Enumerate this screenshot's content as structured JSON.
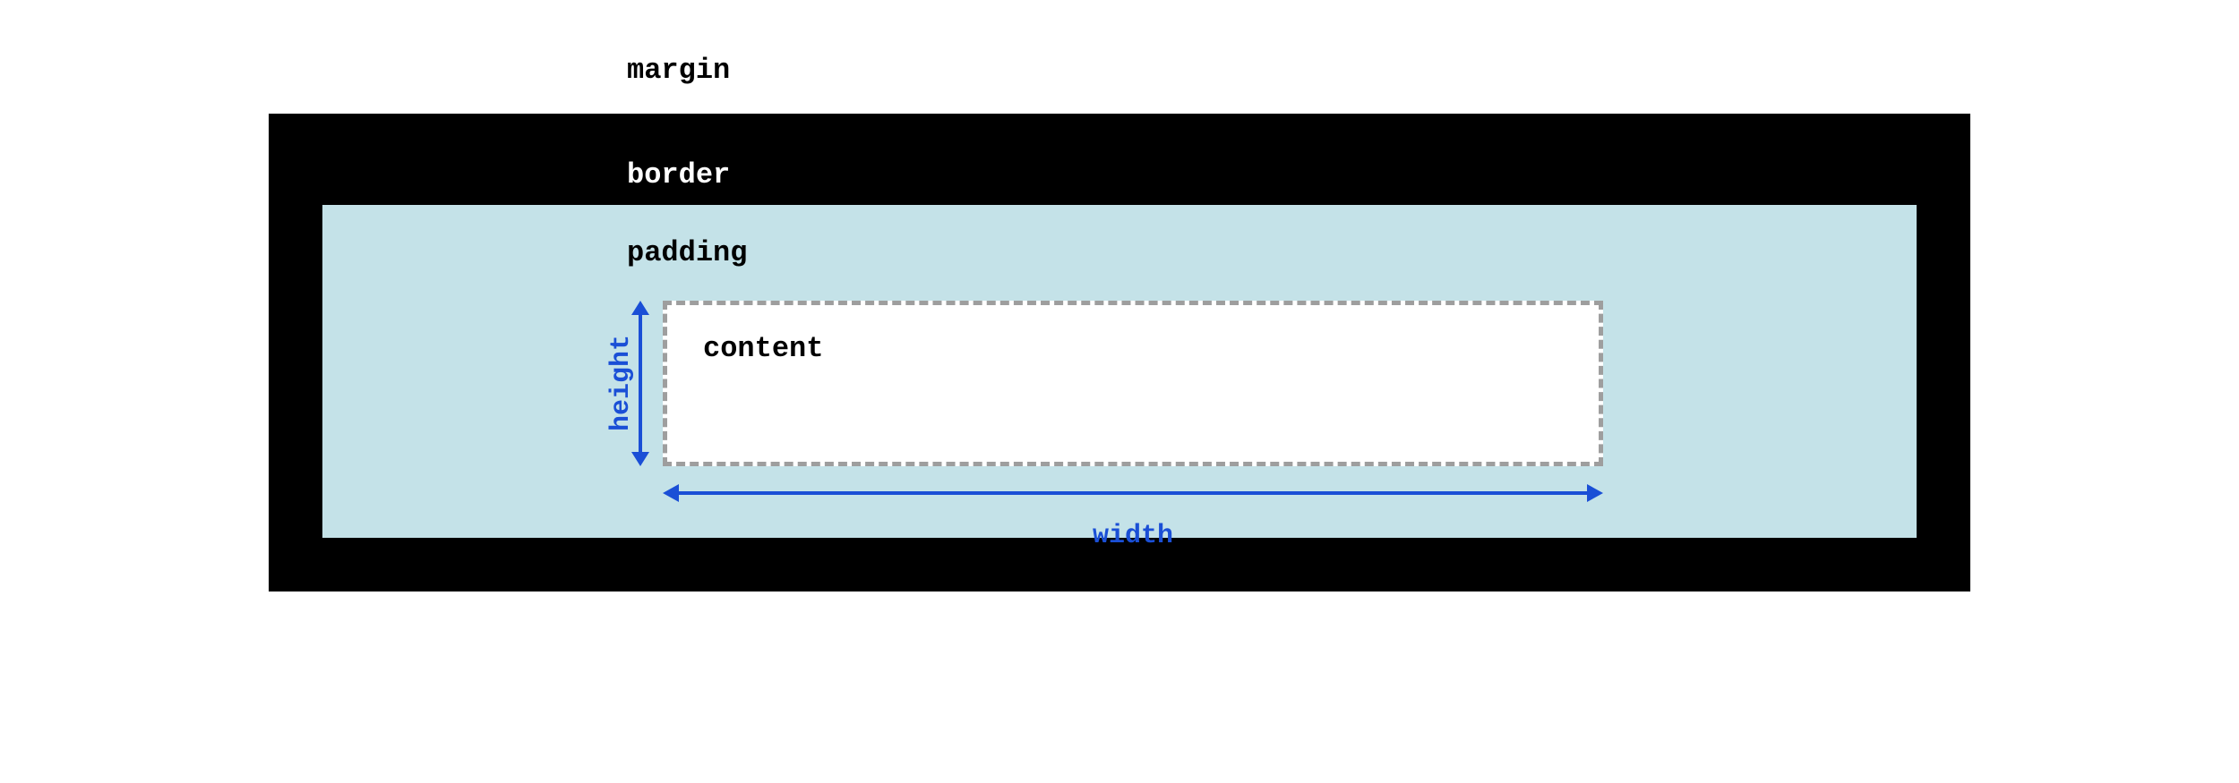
{
  "labels": {
    "margin": "margin",
    "border": "border",
    "padding": "padding",
    "content": "content",
    "height": "height",
    "width": "width"
  },
  "colors": {
    "border_box": "#000000",
    "padding_box": "#c4e2e8",
    "content_box": "#ffffff",
    "dashed_border": "#9e9e9e",
    "arrow": "#1a4fd6"
  }
}
